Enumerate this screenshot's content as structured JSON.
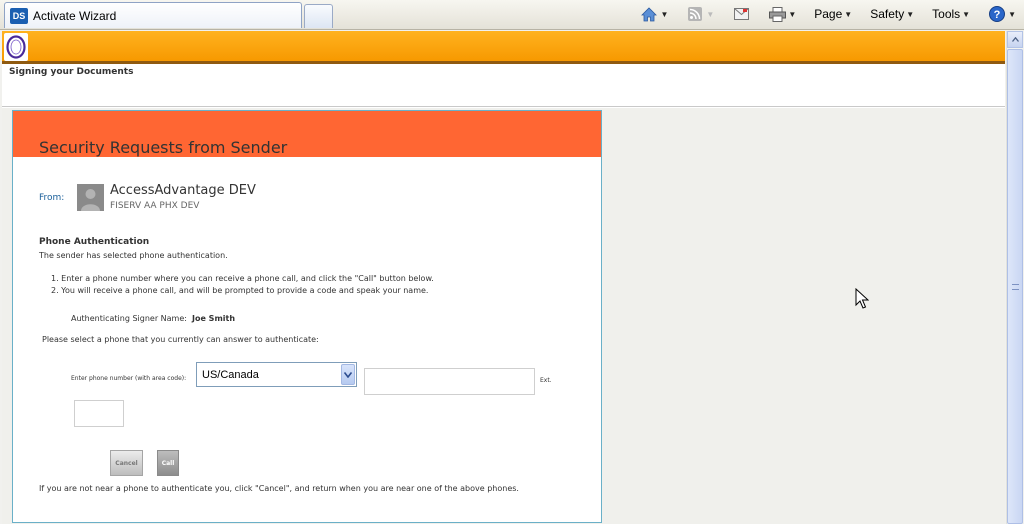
{
  "browser": {
    "tab_title": "Activate Wizard",
    "tab_logo_text": "DS",
    "menu": {
      "page": "Page",
      "safety": "Safety",
      "tools": "Tools"
    },
    "icons": [
      "home-icon",
      "feeds-icon",
      "read-mail-icon",
      "print-icon",
      "help-icon"
    ]
  },
  "page": {
    "subheader_title": "Signing your Documents",
    "panel": {
      "title": "Security Requests from Sender",
      "from_label": "From:",
      "sender_name": "AccessAdvantage DEV",
      "sender_org": "FISERV AA PHX DEV",
      "section_title": "Phone Authentication",
      "section_desc": "The sender has selected phone authentication.",
      "steps": [
        "1.  Enter a phone number where you can receive a phone call, and click the \"Call\" button below.",
        "2.  You will receive a phone call, and will be prompted to provide a code and speak your name."
      ],
      "signer_label": "Authenticating Signer Name:",
      "signer_value": "Joe Smith",
      "phone_prompt": "Please select a phone that you currently can answer to authenticate:",
      "phone_label": "Enter phone number (with area code):",
      "country_selected": "US/Canada",
      "phone_value": "",
      "ext_label": "Ext.",
      "ext_value": "",
      "cancel_label": "Cancel",
      "call_label": "Call",
      "footer_note": "If you are not near a phone to authenticate you, click \"Cancel\", and return when you are near one of the above phones."
    }
  },
  "colors": {
    "orange_header": "#f79900",
    "panel_header": "#ff6633",
    "panel_border": "#6ab0c8",
    "from_label": "#1a5f9a"
  }
}
